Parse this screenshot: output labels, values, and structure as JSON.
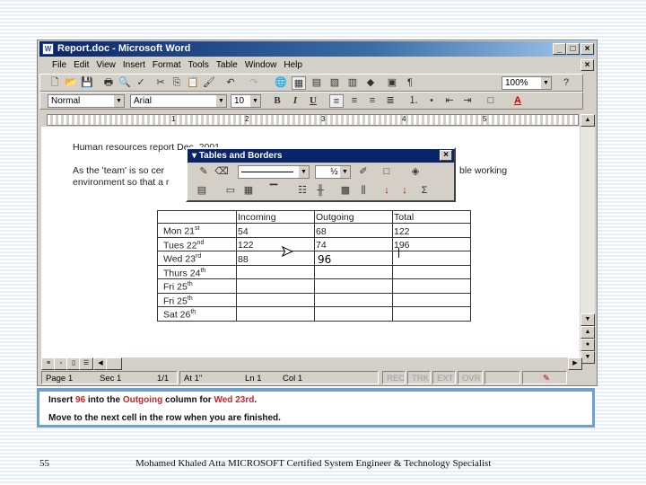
{
  "window": {
    "title": "Report.doc - Microsoft Word"
  },
  "menu": [
    "File",
    "Edit",
    "View",
    "Insert",
    "Format",
    "Tools",
    "Table",
    "Window",
    "Help"
  ],
  "toolbar": {
    "zoom": "100%",
    "style": "Normal",
    "font": "Arial",
    "size": "10",
    "bold": "B",
    "italic": "I",
    "underline": "U"
  },
  "ruler": {
    "marks": [
      "1",
      "2",
      "3",
      "4",
      "5"
    ]
  },
  "document": {
    "line1": "Human resources report Dec. 2001",
    "line2a": "As the 'team' is so cer",
    "line2b": "ble working",
    "line3": "environment so that a r"
  },
  "floating_toolbar": {
    "title": "Tables and Borders",
    "line_weight": "½"
  },
  "table": {
    "headers": [
      "",
      "Incoming",
      "Outgoing",
      "Total"
    ],
    "rows": [
      {
        "day": "Mon 21",
        "sup": "st",
        "in": "54",
        "out": "68",
        "total": "122"
      },
      {
        "day": "Tues 22",
        "sup": "nd",
        "in": "122",
        "out": "74",
        "total": "196"
      },
      {
        "day": "Wed 23",
        "sup": "rd",
        "in": "88",
        "out": "96",
        "total": ""
      },
      {
        "day": "Thurs 24",
        "sup": "th",
        "in": "",
        "out": "",
        "total": ""
      },
      {
        "day": "Fri 25",
        "sup": "th",
        "in": "",
        "out": "",
        "total": ""
      },
      {
        "day": "Fri 25",
        "sup": "th",
        "in": "",
        "out": "",
        "total": ""
      },
      {
        "day": "Sat 26",
        "sup": "th",
        "in": "",
        "out": "",
        "total": ""
      }
    ]
  },
  "status": {
    "page": "Page 1",
    "sec": "Sec 1",
    "pages": "1/1",
    "at": "At 1\"",
    "ln": "Ln 1",
    "col": "Col 1",
    "rec": "REC",
    "trk": "TRK",
    "ext": "EXT",
    "ovr": "OVR"
  },
  "instruction": {
    "p1a": "Insert ",
    "p1b": "96",
    "p1c": " into the ",
    "p1d": "Outgoing",
    "p1e": " column for ",
    "p1f": "Wed 23rd",
    "p1g": ".",
    "p2": "Move to the next cell in the row when you are finished."
  },
  "footer": {
    "page": "55",
    "text": "Mohamed Khaled Atta MICROSOFT Certified System Engineer & Technology Specialist"
  },
  "colors": {
    "title_bar": "#0a246a",
    "highlight": "#c0262b",
    "panel_border": "#6f9fd0"
  }
}
